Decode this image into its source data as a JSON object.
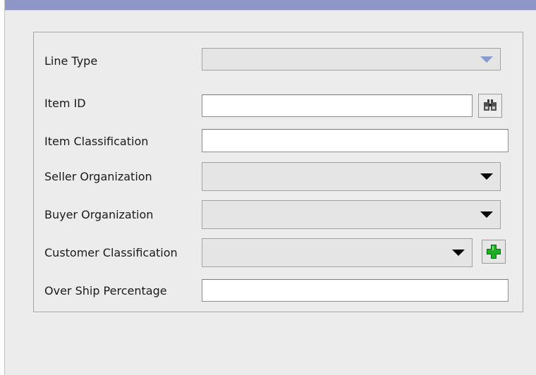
{
  "form": {
    "fields": [
      {
        "label": "Line Type",
        "type": "select",
        "value": "",
        "enabled": false
      },
      {
        "label": "Item ID",
        "type": "text",
        "value": "",
        "lookup_icon": "binoculars-icon"
      },
      {
        "label": "Item Classification",
        "type": "text",
        "value": ""
      },
      {
        "label": "Seller Organization",
        "type": "select",
        "value": ""
      },
      {
        "label": "Buyer Organization",
        "type": "select",
        "value": ""
      },
      {
        "label": "Customer Classification",
        "type": "select",
        "value": "",
        "add_icon": "plus-icon"
      },
      {
        "label": "Over Ship Percentage",
        "type": "text",
        "value": ""
      }
    ]
  },
  "colors": {
    "title_bar": "#8e97c8",
    "panel_background": "#ececec",
    "disabled_arrow": "#8a9ccb",
    "add_icon_green": "#1cae24"
  }
}
